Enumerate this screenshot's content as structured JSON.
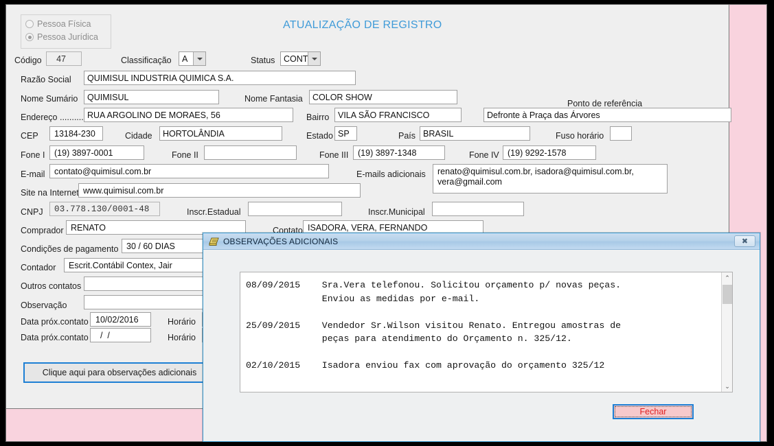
{
  "form": {
    "title": "ATUALIZAÇÃO DE REGISTRO",
    "person_type": {
      "fisica_label": "Pessoa Física",
      "juridica_label": "Pessoa Jurídica",
      "selected": "juridica"
    },
    "fields": {
      "codigo_label": "Código",
      "codigo_value": "47",
      "classificacao_label": "Classificação",
      "classificacao_value": "A",
      "status_label": "Status",
      "status_value": "CONT",
      "razao_social_label": "Razão Social",
      "razao_social_value": "QUIMISUL INDUSTRIA QUIMICA S.A.",
      "nome_sumario_label": "Nome Sumário",
      "nome_sumario_value": "QUIMISUL",
      "nome_fantasia_label": "Nome Fantasia",
      "nome_fantasia_value": "COLOR SHOW",
      "endereco_label": "Endereço ..........",
      "endereco_value": "RUA ARGOLINO DE MORAES, 56",
      "bairro_label": "Bairro",
      "bairro_value": "VILA SÃO FRANCISCO",
      "ponto_referencia_label": "Ponto de referência",
      "ponto_referencia_value": "Defronte à Praça das Árvores",
      "cep_label": "CEP",
      "cep_value": "13184-230",
      "cidade_label": "Cidade",
      "cidade_value": "HORTOLÂNDIA",
      "estado_label": "Estado",
      "estado_value": "SP",
      "pais_label": "País",
      "pais_value": "BRASIL",
      "fuso_horario_label": "Fuso horário",
      "fuso_horario_value": "",
      "fone1_label": "Fone I",
      "fone1_value": "(19) 3897-0001",
      "fone2_label": "Fone II",
      "fone2_value": "",
      "fone3_label": "Fone III",
      "fone3_value": "(19) 3897-1348",
      "fone4_label": "Fone IV",
      "fone4_value": "(19) 9292-1578",
      "email_label": "E-mail",
      "email_value": "contato@quimisul.com.br",
      "emails_adicionais_label": "E-mails adicionais",
      "emails_adicionais_value": "renato@quimisul.com.br, isadora@quimisul.com.br, vera@gmail.com",
      "site_label": "Site na Internet",
      "site_value": "www.quimisul.com.br",
      "cnpj_label": "CNPJ",
      "cnpj_value": "03.778.130/0001-48",
      "inscr_estadual_label": "Inscr.Estadual",
      "inscr_estadual_value": "",
      "inscr_municipal_label": "Inscr.Municipal",
      "inscr_municipal_value": "",
      "comprador_label": "Comprador",
      "comprador_value": "RENATO",
      "contato_label": "Contato",
      "contato_value": "ISADORA, VERA, FERNANDO",
      "condicoes_label": "Condições de pagamento",
      "condicoes_value": "30 / 60 DIAS",
      "contador_label": "Contador",
      "contador_value": "Escrit.Contábil Contex, Jair",
      "outros_contatos_label": "Outros contatos",
      "outros_contatos_value": "",
      "observacao_label": "Observação",
      "observacao_value": "",
      "data_prox1_label": "Data próx.contato",
      "data_prox1_value": "10/02/2016",
      "horario1_label": "Horário",
      "horario1_value": "",
      "data_prox2_label": "Data próx.contato",
      "data_prox2_value": "/  /",
      "horario2_label": "Horário",
      "horario2_value": ""
    },
    "obs_button_label": "Clique aqui para observações adicionais"
  },
  "dialog": {
    "title": "OBSERVAÇÕES ADICIONAIS",
    "icon": "notes-icon",
    "close_icon": "✖",
    "notes": "08/09/2015    Sra.Vera telefonou. Solicitou orçamento p/ novas peças.\n              Enviou as medidas por e-mail.\n\n25/09/2015    Vendedor Sr.Wilson visitou Renato. Entregou amostras de\n              peças para atendimento do Orçamento n. 325/12.\n\n02/10/2015    Isadora enviou fax com aprovação do orçamento 325/12",
    "close_button_label": "Fechar",
    "scroll_up": "⌃",
    "scroll_down": "⌄"
  },
  "colors": {
    "title_blue": "#3f9bd8",
    "accent_blue": "#1d7fd4",
    "pink_panel": "#f9d3de",
    "close_button_bg": "#f6c9cc",
    "close_button_text": "#e02020"
  }
}
